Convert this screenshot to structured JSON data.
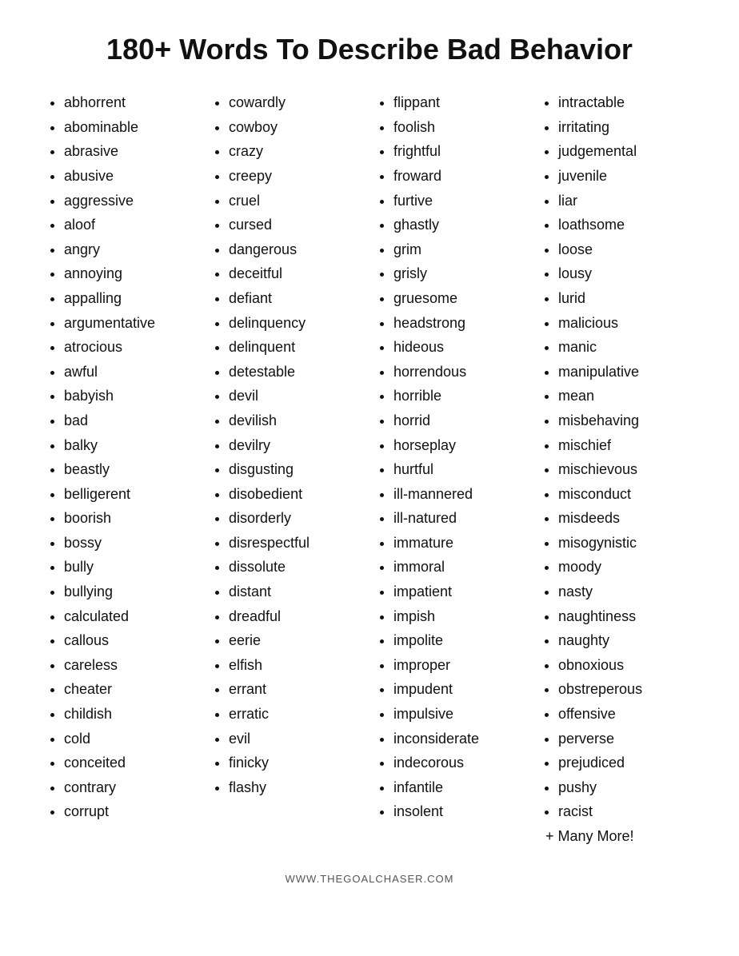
{
  "title": "180+ Words To Describe Bad Behavior",
  "columns": [
    {
      "id": "col1",
      "items": [
        "abhorrent",
        "abominable",
        "abrasive",
        "abusive",
        "aggressive",
        "aloof",
        "angry",
        "annoying",
        "appalling",
        "argumentative",
        "atrocious",
        "awful",
        "babyish",
        "bad",
        "balky",
        "beastly",
        "belligerent",
        "boorish",
        "bossy",
        "bully",
        "bullying",
        "calculated",
        "callous",
        "careless",
        "cheater",
        "childish",
        "cold",
        "conceited",
        "contrary",
        "corrupt"
      ]
    },
    {
      "id": "col2",
      "items": [
        "cowardly",
        "cowboy",
        "crazy",
        "creepy",
        "cruel",
        "cursed",
        "dangerous",
        "deceitful",
        "defiant",
        "delinquency",
        "delinquent",
        "detestable",
        "devil",
        "devilish",
        "devilry",
        "disgusting",
        "disobedient",
        "disorderly",
        "disrespectful",
        "dissolute",
        "distant",
        "dreadful",
        "eerie",
        "elfish",
        "errant",
        "erratic",
        "evil",
        "finicky",
        "flashy"
      ]
    },
    {
      "id": "col3",
      "items": [
        "flippant",
        "foolish",
        "frightful",
        "froward",
        "furtive",
        "ghastly",
        "grim",
        "grisly",
        "gruesome",
        "headstrong",
        "hideous",
        "horrendous",
        "horrible",
        "horrid",
        "horseplay",
        "hurtful",
        "ill-mannered",
        "ill-natured",
        "immature",
        "immoral",
        "impatient",
        "impish",
        "impolite",
        "improper",
        "impudent",
        "impulsive",
        "inconsiderate",
        "indecorous",
        "infantile",
        "insolent"
      ]
    },
    {
      "id": "col4",
      "items": [
        "intractable",
        "irritating",
        "judgemental",
        "juvenile",
        "liar",
        "loathsome",
        "loose",
        "lousy",
        "lurid",
        "malicious",
        "manic",
        "manipulative",
        "mean",
        "misbehaving",
        "mischief",
        "mischievous",
        "misconduct",
        "misdeeds",
        "misogynistic",
        "moody",
        "nasty",
        "naughtiness",
        "naughty",
        "obnoxious",
        "obstreperous",
        "offensive",
        "perverse",
        "prejudiced",
        "pushy",
        "racist"
      ],
      "suffix": "+ Many More!"
    }
  ],
  "footer": "WWW.THEGOALCHASER.COM"
}
